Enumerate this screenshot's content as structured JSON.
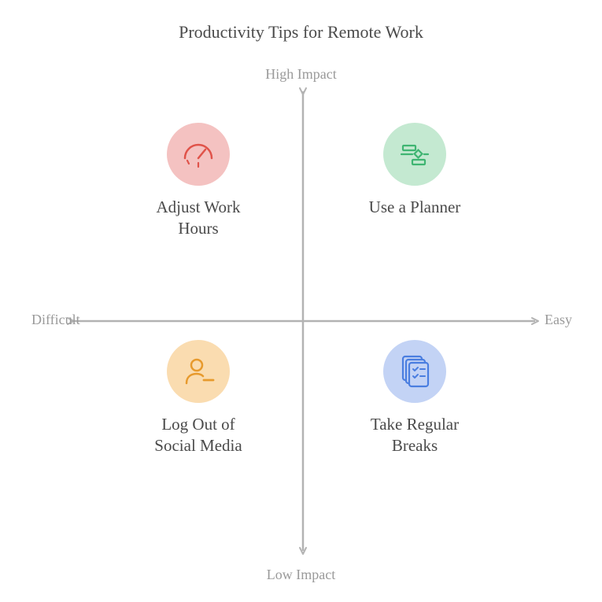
{
  "chart_data": {
    "type": "quadrant",
    "title": "Productivity Tips for Remote Work",
    "x_axis": {
      "negative": "Difficult",
      "positive": "Easy"
    },
    "y_axis": {
      "negative": "Low Impact",
      "positive": "High Impact"
    },
    "items": [
      {
        "label": "Adjust Work Hours",
        "quadrant": "top-left",
        "icon": "gauge",
        "color": "#e26b62"
      },
      {
        "label": "Use a Planner",
        "quadrant": "top-right",
        "icon": "gantt",
        "color": "#3fb572"
      },
      {
        "label": "Log Out of Social Media",
        "quadrant": "bottom-left",
        "icon": "user-minus",
        "color": "#e79a2d"
      },
      {
        "label": "Take Regular Breaks",
        "quadrant": "bottom-right",
        "icon": "checklists",
        "color": "#4a7ee0"
      }
    ]
  }
}
